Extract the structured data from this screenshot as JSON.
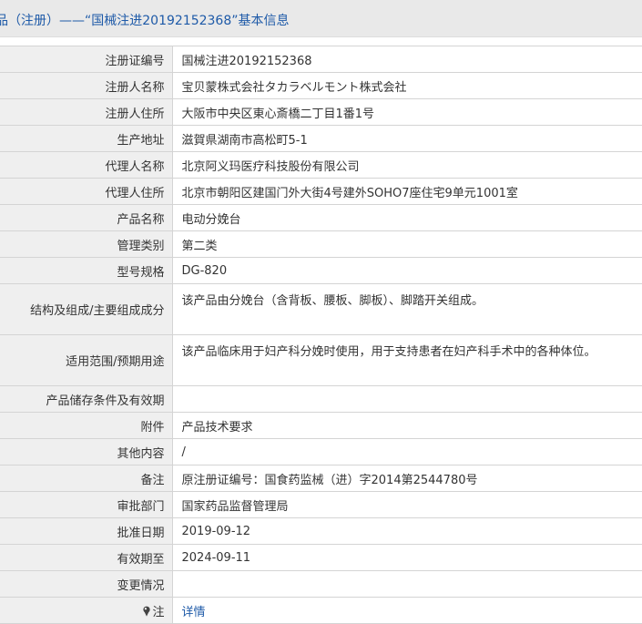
{
  "header": {
    "title": "品（注册）——“国械注进20192152368”基本信息"
  },
  "rows": [
    {
      "label": "注册证编号",
      "value": "国械注进20192152368"
    },
    {
      "label": "注册人名称",
      "value": "宝贝蒙株式会社タカラベルモント株式会社"
    },
    {
      "label": "注册人住所",
      "value": "大阪市中央区東心斎橋二丁目1番1号"
    },
    {
      "label": "生产地址",
      "value": "滋賀県湖南市高松町5-1"
    },
    {
      "label": "代理人名称",
      "value": "北京阿义玛医疗科技股份有限公司"
    },
    {
      "label": "代理人住所",
      "value": "北京市朝阳区建国门外大街4号建外SOHO7座住宅9单元1001室"
    },
    {
      "label": "产品名称",
      "value": "电动分娩台"
    },
    {
      "label": "管理类别",
      "value": "第二类"
    },
    {
      "label": "型号规格",
      "value": "DG-820"
    },
    {
      "label": "结构及组成/主要组成成分",
      "value": "该产品由分娩台（含背板、腰板、脚板）、脚踏开关组成。"
    },
    {
      "label": "适用范围/预期用途",
      "value": "该产品临床用于妇产科分娩时使用，用于支持患者在妇产科手术中的各种体位。"
    },
    {
      "label": "产品储存条件及有效期",
      "value": ""
    },
    {
      "label": "附件",
      "value": "产品技术要求"
    },
    {
      "label": "其他内容",
      "value": "/"
    },
    {
      "label": "备注",
      "value": "原注册证编号：国食药监械（进）字2014第2544780号"
    },
    {
      "label": "审批部门",
      "value": "国家药品监督管理局"
    },
    {
      "label": "批准日期",
      "value": "2019-09-12"
    },
    {
      "label": "有效期至",
      "value": "2024-09-11"
    },
    {
      "label": "变更情况",
      "value": ""
    },
    {
      "label": "注",
      "value": "详情"
    }
  ],
  "icons": {
    "note": "pin-icon"
  },
  "colors": {
    "link": "#1e5aa8",
    "label_bg": "#efefef",
    "header_bg": "#e9e9e9",
    "border": "#d4d4d4"
  }
}
